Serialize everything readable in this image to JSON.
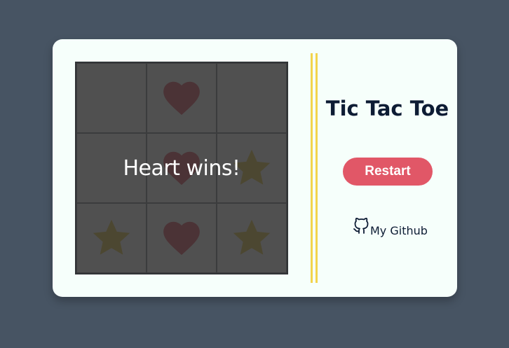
{
  "game": {
    "title": "Tic Tac Toe",
    "status_text": "Heart wins!",
    "winner": "heart",
    "board": [
      [
        "empty",
        "heart",
        "empty"
      ],
      [
        "empty",
        "heart",
        "star"
      ],
      [
        "star",
        "heart",
        "star"
      ]
    ]
  },
  "controls": {
    "restart_label": "Restart"
  },
  "footer": {
    "github_label": "My Github",
    "github_icon": "github-icon"
  },
  "colors": {
    "background": "#475463",
    "card": "#f6fffb",
    "heart": "#d2162f",
    "star": "#d9b400",
    "divider": "#f2d44c",
    "restart_button": "#e15767",
    "title_text": "#0d1c34"
  }
}
